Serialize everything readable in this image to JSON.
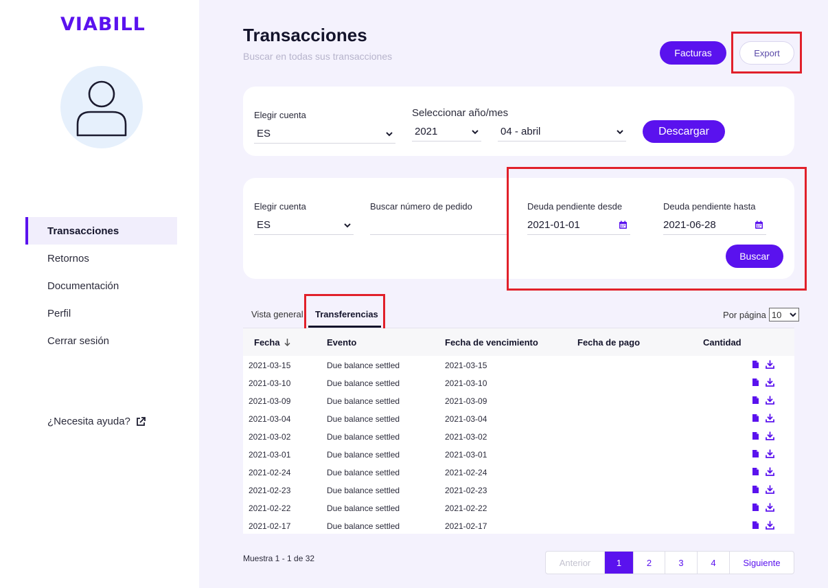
{
  "brand": {
    "logo_text": "VIABILL",
    "accent": "#5a12ee"
  },
  "sidebar": {
    "items": [
      {
        "label": "Transacciones",
        "active": true
      },
      {
        "label": "Retornos"
      },
      {
        "label": "Documentación"
      },
      {
        "label": "Perfil"
      },
      {
        "label": "Cerrar sesión"
      }
    ],
    "help": "¿Necesita ayuda?"
  },
  "header": {
    "title": "Transacciones",
    "subtitle": "Buscar en todas sus transacciones",
    "facturas_label": "Facturas",
    "export_label": "Export"
  },
  "download_card": {
    "account_label": "Elegir cuenta",
    "account_value": "ES",
    "period_label": "Seleccionar año/mes",
    "year_value": "2021",
    "month_value": "04 - abril",
    "button_label": "Descargar"
  },
  "search_card": {
    "account_label": "Elegir cuenta",
    "account_value": "ES",
    "order_label": "Buscar número de pedido",
    "order_value": "",
    "from_label": "Deuda pendiente desde",
    "from_value": "2021-01-01",
    "to_label": "Deuda pendiente hasta",
    "to_value": "2021-06-28",
    "button_label": "Buscar"
  },
  "tabs": [
    {
      "label": "Vista general"
    },
    {
      "label": "Transferencias",
      "active": true
    }
  ],
  "per_page": {
    "label": "Por página",
    "value": "10"
  },
  "table": {
    "headers": [
      "Fecha",
      "Evento",
      "Fecha de vencimiento",
      "Fecha de pago",
      "Cantidad"
    ],
    "rows": [
      {
        "date": "2021-03-15",
        "event": "Due balance settled",
        "due": "2021-03-15",
        "paid": "",
        "amount": ""
      },
      {
        "date": "2021-03-10",
        "event": "Due balance settled",
        "due": "2021-03-10",
        "paid": "",
        "amount": ""
      },
      {
        "date": "2021-03-09",
        "event": "Due balance settled",
        "due": "2021-03-09",
        "paid": "",
        "amount": ""
      },
      {
        "date": "2021-03-04",
        "event": "Due balance settled",
        "due": "2021-03-04",
        "paid": "",
        "amount": ""
      },
      {
        "date": "2021-03-02",
        "event": "Due balance settled",
        "due": "2021-03-02",
        "paid": "",
        "amount": ""
      },
      {
        "date": "2021-03-01",
        "event": "Due balance settled",
        "due": "2021-03-01",
        "paid": "",
        "amount": ""
      },
      {
        "date": "2021-02-24",
        "event": "Due balance settled",
        "due": "2021-02-24",
        "paid": "",
        "amount": ""
      },
      {
        "date": "2021-02-23",
        "event": "Due balance settled",
        "due": "2021-02-23",
        "paid": "",
        "amount": ""
      },
      {
        "date": "2021-02-22",
        "event": "Due balance settled",
        "due": "2021-02-22",
        "paid": "",
        "amount": ""
      },
      {
        "date": "2021-02-17",
        "event": "Due balance settled",
        "due": "2021-02-17",
        "paid": "",
        "amount": ""
      }
    ],
    "row_icons": [
      "document-icon",
      "download-icon"
    ]
  },
  "pagination": {
    "summary": "Muestra 1 - 1 de 32",
    "prev": "Anterior",
    "pages": [
      "1",
      "2",
      "3",
      "4"
    ],
    "current": "1",
    "next": "Siguiente"
  }
}
